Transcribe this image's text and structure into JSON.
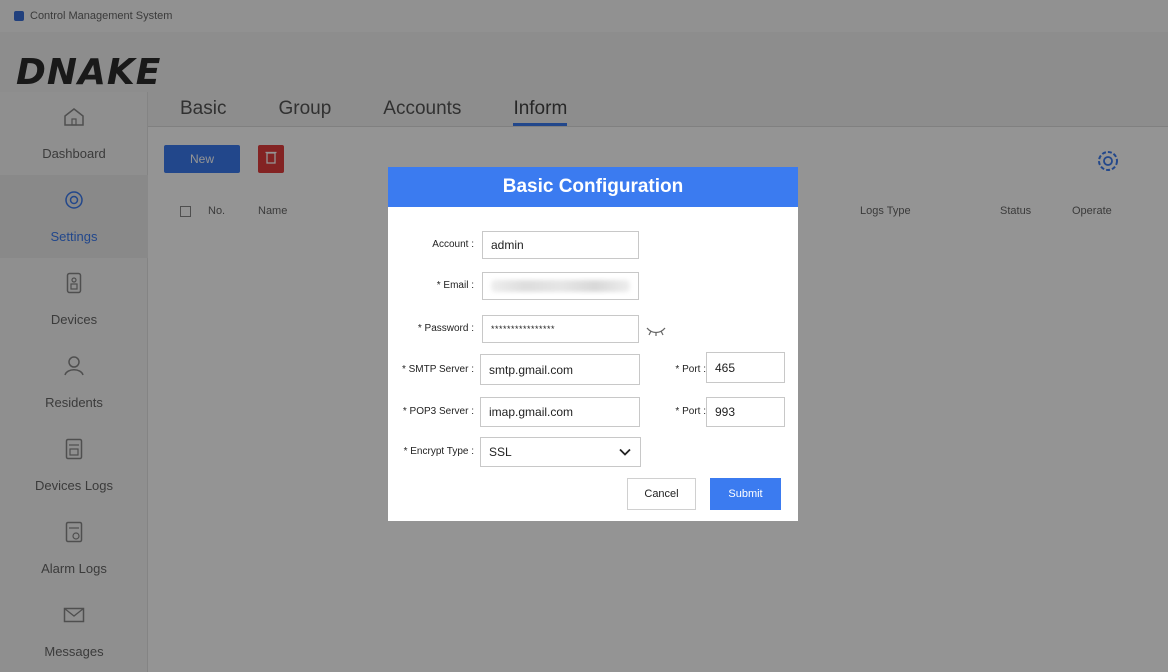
{
  "window": {
    "title": "Control Management System"
  },
  "brand": {
    "logo_text": "DNAKE"
  },
  "sidebar": {
    "items": [
      {
        "label": "Dashboard",
        "icon": "home-icon"
      },
      {
        "label": "Settings",
        "icon": "settings-icon",
        "active": true
      },
      {
        "label": "Devices",
        "icon": "device-icon"
      },
      {
        "label": "Residents",
        "icon": "user-icon"
      },
      {
        "label": "Devices Logs",
        "icon": "log-icon"
      },
      {
        "label": "Alarm Logs",
        "icon": "alarm-log-icon"
      },
      {
        "label": "Messages",
        "icon": "mail-icon"
      }
    ]
  },
  "tabs": [
    {
      "label": "Basic"
    },
    {
      "label": "Group"
    },
    {
      "label": "Accounts"
    },
    {
      "label": "Inform",
      "active": true
    }
  ],
  "toolbar": {
    "new_label": "New"
  },
  "table": {
    "headers": [
      "No.",
      "Name",
      "Logs Type",
      "Status",
      "Operate"
    ]
  },
  "modal": {
    "title": "Basic Configuration",
    "account_label": "Account :",
    "account_value": "admin",
    "email_label": "* Email :",
    "password_label": "* Password :",
    "password_value": "****************",
    "smtp_label": "* SMTP Server :",
    "smtp_value": "smtp.gmail.com",
    "smtp_port_label": "* Port :",
    "smtp_port_value": "465",
    "pop3_label": "* POP3 Server :",
    "pop3_value": "imap.gmail.com",
    "pop3_port_label": "* Port :",
    "pop3_port_value": "993",
    "encrypt_label": "* Encrypt Type :",
    "encrypt_value": "SSL",
    "cancel_label": "Cancel",
    "submit_label": "Submit"
  },
  "colors": {
    "accent": "#3b7bf0",
    "danger": "#e23d3d"
  }
}
